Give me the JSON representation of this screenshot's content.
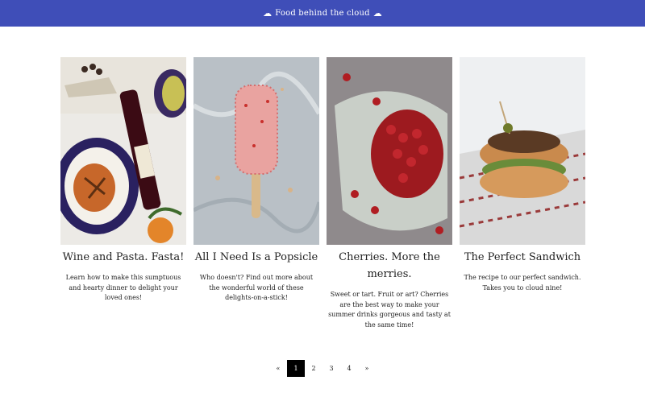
{
  "header": {
    "title": "Food behind the cloud",
    "left_icon": "cloud-icon",
    "right_icon": "cloud-icon"
  },
  "cards": [
    {
      "title": "Wine and Pasta. Fasta!",
      "description": "Learn how to make this sumptuous and hearty dinner to delight your loved ones!",
      "image": "wine-pasta-photo"
    },
    {
      "title": "All I Need Is a Popsicle",
      "description": "Who doesn't? Find out more about the wonderful world of these delights-on-a-stick!",
      "image": "popsicle-photo"
    },
    {
      "title": "Cherries. More the merries.",
      "description": "Sweet or tart. Fruit or art? Cherries are the best way to make your summer drinks gorgeous and tasty at the same time!",
      "image": "cherries-photo"
    },
    {
      "title": "The Perfect Sandwich",
      "description": "The recipe to our perfect sandwich. Takes you to cloud nine!",
      "image": "sandwich-photo"
    }
  ],
  "pagination": {
    "prev": "«",
    "pages": [
      "1",
      "2",
      "3",
      "4"
    ],
    "next": "»",
    "current": "1"
  }
}
